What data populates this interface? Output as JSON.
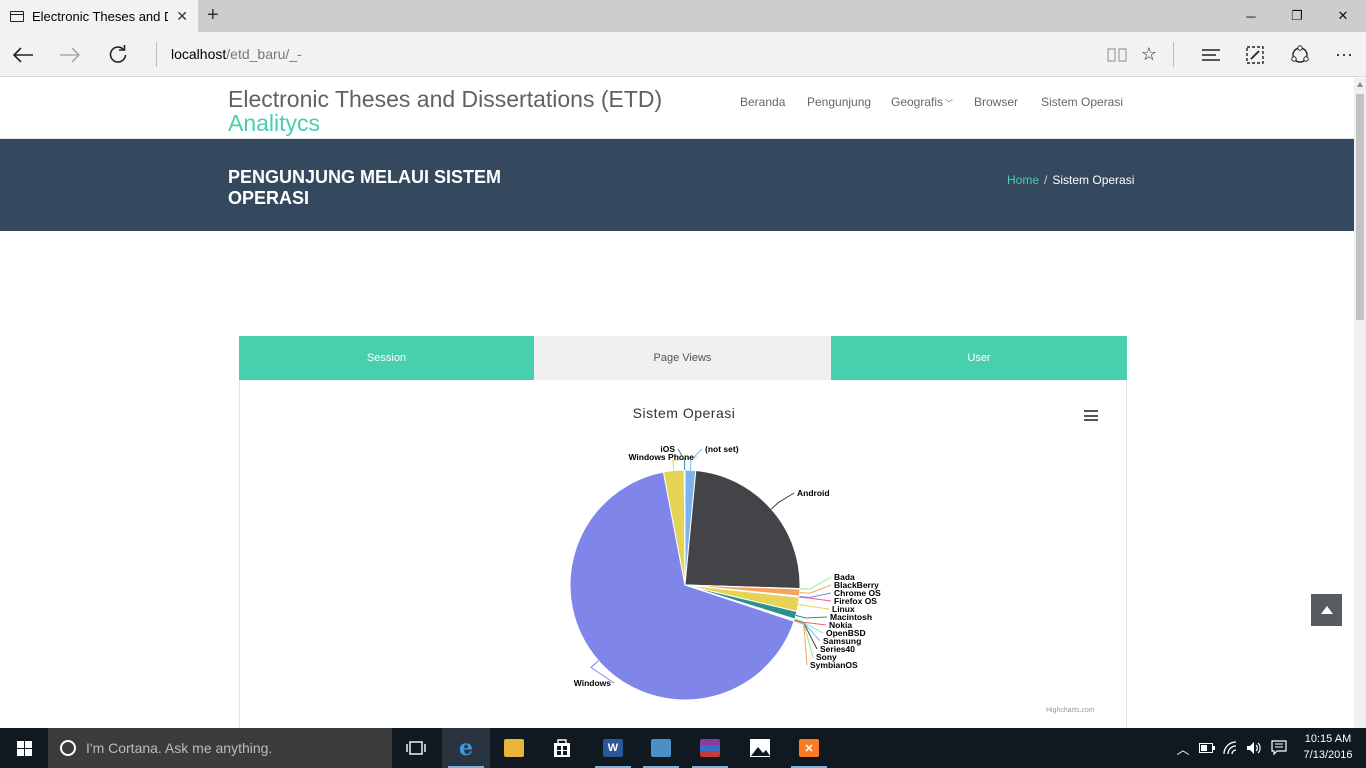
{
  "browser": {
    "tab_title": "Electronic Theses and Di",
    "tab_close": "✕",
    "new_tab": "+",
    "url_host": "localhost",
    "url_path": "/etd_baru/_-"
  },
  "site": {
    "title": "Electronic Theses and Dissertations (ETD)",
    "subtitle": "Analitycs",
    "nav": [
      "Beranda",
      "Pengunjung",
      "Geografis",
      "Browser",
      "Sistem Operasi"
    ]
  },
  "banner": {
    "title": "PENGUNJUNG MELAUI SISTEM OPERASI",
    "breadcrumb_home": "Home",
    "breadcrumb_sep": "/",
    "breadcrumb_current": "Sistem Operasi"
  },
  "tabs": [
    "Session",
    "Page Views",
    "User"
  ],
  "colors": {
    "accent": "#48cfad",
    "banner": "#34495e"
  },
  "chart_data": {
    "type": "pie",
    "title": "Sistem Operasi",
    "credits": "Highcharts.com",
    "slices": [
      {
        "name": "(not set)",
        "value": 1.5,
        "color": "#7cb5ec"
      },
      {
        "name": "Android",
        "value": 24.0,
        "color": "#434348"
      },
      {
        "name": "Bada",
        "value": 0.05,
        "color": "#90ed7d"
      },
      {
        "name": "BlackBerry",
        "value": 1.0,
        "color": "#f7a35c"
      },
      {
        "name": "Chrome OS",
        "value": 0.1,
        "color": "#8085e9"
      },
      {
        "name": "Firefox OS",
        "value": 0.05,
        "color": "#f15c80"
      },
      {
        "name": "Linux",
        "value": 2.0,
        "color": "#e4d354"
      },
      {
        "name": "Macintosh",
        "value": 1.1,
        "color": "#2b908f"
      },
      {
        "name": "Nokia",
        "value": 0.05,
        "color": "#f45b5b"
      },
      {
        "name": "OpenBSD",
        "value": 0.05,
        "color": "#91e8e1"
      },
      {
        "name": "Samsung",
        "value": 0.05,
        "color": "#7cb5ec"
      },
      {
        "name": "Series40",
        "value": 0.05,
        "color": "#434348"
      },
      {
        "name": "Sony",
        "value": 0.05,
        "color": "#90ed7d"
      },
      {
        "name": "SymbianOS",
        "value": 0.05,
        "color": "#f7a35c"
      },
      {
        "name": "Windows",
        "value": 66.9,
        "color": "#8085e9"
      },
      {
        "name": "Windows Phone",
        "value": 2.9,
        "color": "#e4d354"
      },
      {
        "name": "iOS",
        "value": 0.1,
        "color": "#2b908f"
      }
    ]
  },
  "taskbar": {
    "cortana_placeholder": "I'm Cortana. Ask me anything.",
    "time": "10:15 AM",
    "date": "7/13/2016"
  }
}
